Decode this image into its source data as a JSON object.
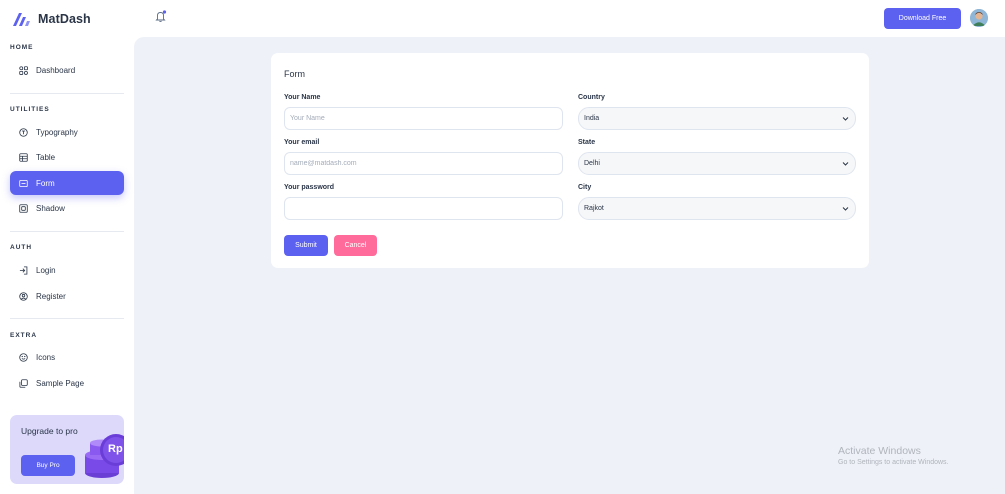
{
  "brand": {
    "name": "MatDash",
    "accent": "#5d61f0"
  },
  "topbar": {
    "download_label": "Download Free",
    "notification_icon": "bell-icon"
  },
  "sidebar": {
    "sections": {
      "home": "HOME",
      "utilities": "UTILITIES",
      "auth": "AUTH",
      "extra": "EXTRA"
    },
    "items": [
      {
        "label": "Dashboard",
        "icon": "dashboard-icon",
        "active": false
      },
      {
        "label": "Typography",
        "icon": "typography-icon",
        "active": false
      },
      {
        "label": "Table",
        "icon": "table-icon",
        "active": false
      },
      {
        "label": "Form",
        "icon": "form-icon",
        "active": true
      },
      {
        "label": "Shadow",
        "icon": "shadow-icon",
        "active": false
      },
      {
        "label": "Login",
        "icon": "login-icon",
        "active": false
      },
      {
        "label": "Register",
        "icon": "register-icon",
        "active": false
      },
      {
        "label": "Icons",
        "icon": "smiley-icon",
        "active": false
      },
      {
        "label": "Sample Page",
        "icon": "sample-page-icon",
        "active": false
      }
    ],
    "upgrade": {
      "title": "Upgrade to pro",
      "button": "Buy Pro",
      "badge": "Rp"
    }
  },
  "form": {
    "title": "Form",
    "name_label": "Your Name",
    "name_placeholder": "Your Name",
    "email_label": "Your email",
    "email_placeholder": "name@matdash.com",
    "password_label": "Your password",
    "country_label": "Country",
    "country_value": "India",
    "state_label": "State",
    "state_value": "Delhi",
    "city_label": "City",
    "city_value": "Rajkot",
    "submit_label": "Submit",
    "cancel_label": "Cancel",
    "cancel_color": "#ff6b9a"
  },
  "watermark": {
    "title": "Activate Windows",
    "subtitle": "Go to Settings to activate Windows."
  }
}
